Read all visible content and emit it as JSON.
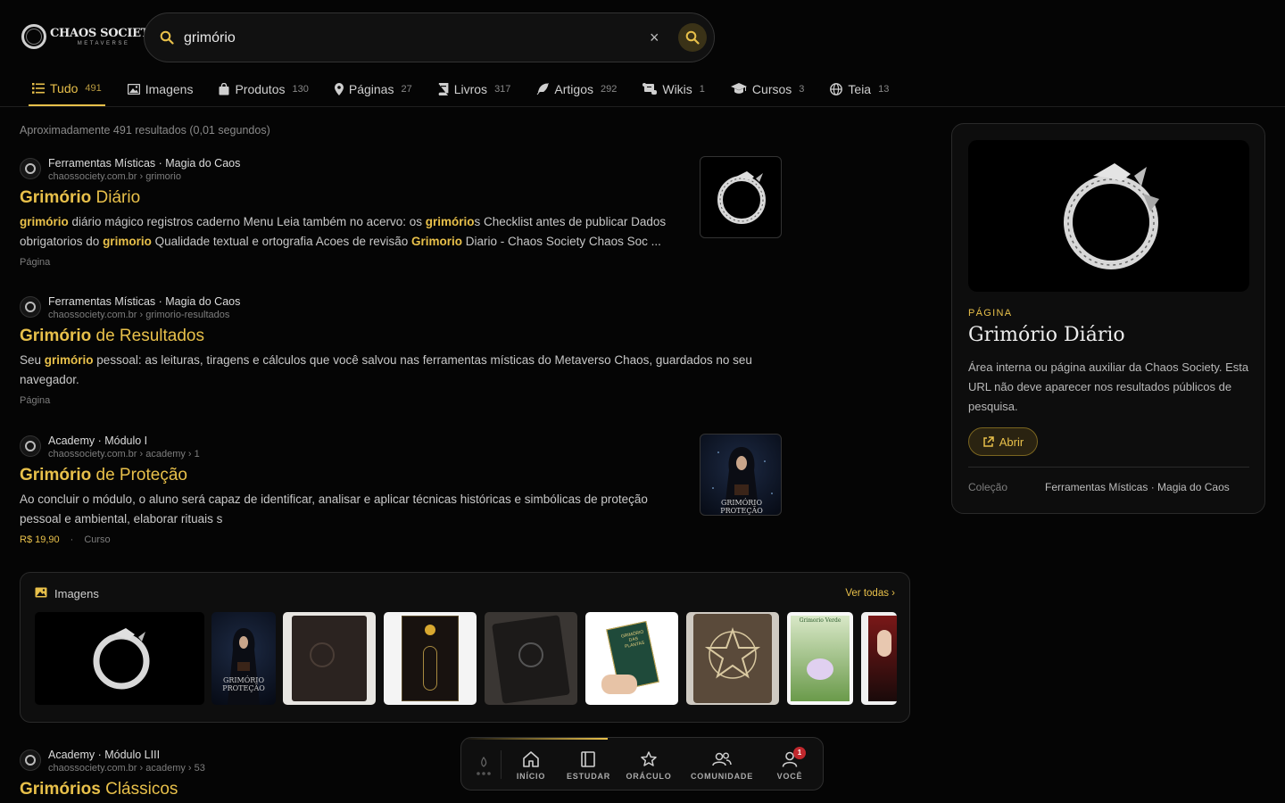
{
  "brand": {
    "name": "CHAOS SOCIETY",
    "tagline": "METAVERSE"
  },
  "search": {
    "query": "grimório",
    "clear_label": "×"
  },
  "tabs": [
    {
      "label": "Tudo",
      "count": "491",
      "icon": "list-icon",
      "active": true
    },
    {
      "label": "Imagens",
      "count": "",
      "icon": "image-icon"
    },
    {
      "label": "Produtos",
      "count": "130",
      "icon": "bag-icon"
    },
    {
      "label": "Páginas",
      "count": "27",
      "icon": "pin-icon"
    },
    {
      "label": "Livros",
      "count": "317",
      "icon": "book-icon"
    },
    {
      "label": "Artigos",
      "count": "292",
      "icon": "feather-icon"
    },
    {
      "label": "Wikis",
      "count": "1",
      "icon": "scroll-icon"
    },
    {
      "label": "Cursos",
      "count": "3",
      "icon": "graduation-cap-icon"
    },
    {
      "label": "Teia",
      "count": "13",
      "icon": "globe-icon"
    }
  ],
  "stats": "Aproximadamente 491 resultados (0,01 segundos)",
  "results": [
    {
      "site": "Ferramentas Místicas · Magia do Caos",
      "url": "chaossociety.com.br › grimorio",
      "title_hl": "Grimório",
      "title_rest": " Diário",
      "snippet": [
        {
          "t": "grimório",
          "hl": true
        },
        {
          "t": " diário mágico registros caderno Menu Leia também no acervo: os "
        },
        {
          "t": "grimório",
          "hl": true
        },
        {
          "t": "s Checklist antes de publicar Dados obrigatorios do "
        },
        {
          "t": "grimorio",
          "hl": true
        },
        {
          "t": " Qualidade textual e ortografia Acoes de revisão "
        },
        {
          "t": "Grimorio",
          "hl": true
        },
        {
          "t": " Diario - Chaos Society Chaos Soc ..."
        }
      ],
      "type": "Página"
    },
    {
      "site": "Ferramentas Místicas · Magia do Caos",
      "url": "chaossociety.com.br › grimorio-resultados",
      "title_hl": "Grimório",
      "title_rest": " de Resultados",
      "snippet": [
        {
          "t": "Seu "
        },
        {
          "t": "grimório",
          "hl": true
        },
        {
          "t": " pessoal: as leituras, tiragens e cálculos que você salvou nas ferramentas místicas do Metaverso Chaos, guardados no seu navegador."
        }
      ],
      "type": "Página"
    },
    {
      "site": "Academy · Módulo I",
      "url": "chaossociety.com.br › academy › 1",
      "title_hl": "Grimório",
      "title_rest": " de Proteção",
      "snippet": [
        {
          "t": "Ao concluir o módulo, o aluno será capaz de identificar, analisar e aplicar técnicas históricas e simbólicas de proteção pessoal e ambiental, elaborar rituais s"
        }
      ],
      "price": "R$ 19,90",
      "sep": "·",
      "type": "Curso",
      "thumb_text": "GRIMÓRIO PROTEÇÃO"
    },
    {
      "site": "Academy · Módulo LIII",
      "url": "chaossociety.com.br › academy › 53",
      "title_hl": "Grimórios",
      "title_rest": " Clássicos"
    }
  ],
  "images_panel": {
    "title": "Imagens",
    "more": "Ver todas ›",
    "book2_text": "GRIMÓRIO PROTEÇÃO",
    "book_green_title": "GRIMÓRIO DAS PLANTAS",
    "book_verde_title": "Grimorio Verde"
  },
  "side_card": {
    "kicker": "PÁGINA",
    "title": "Grimório Diário",
    "description": "Área interna ou página auxiliar da Chaos Society. Esta URL não deve aparecer nos resultados públicos de pesquisa.",
    "button": "Abrir",
    "meta_key": "Coleção",
    "meta_value": "Ferramentas Místicas · Magia do Caos"
  },
  "bottom_nav": {
    "items": [
      {
        "label": "INÍCIO",
        "icon": "home-icon"
      },
      {
        "label": "ESTUDAR",
        "icon": "book-open-icon"
      },
      {
        "label": "ORÁCULO",
        "icon": "star-icon"
      },
      {
        "label": "COMUNIDADE",
        "icon": "users-icon"
      },
      {
        "label": "VOCÊ",
        "icon": "user-icon",
        "badge": "1"
      }
    ]
  },
  "colors": {
    "accent": "#e8c04a",
    "background": "#050505",
    "surface": "#0e0e0e",
    "badge": "#c0282d"
  }
}
